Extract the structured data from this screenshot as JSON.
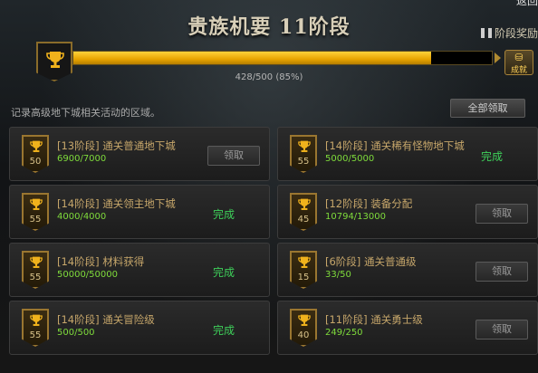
{
  "header": {
    "corner_label": "返回",
    "title": "贵族机要 11阶段",
    "stage_reward_label": "阶段奖励",
    "achievement_label": "成就",
    "progress_text": "428/500 (85%)",
    "progress_fraction": 0.856
  },
  "description": "记录高级地下城相关活动的区域。",
  "all_claim_label": "全部领取",
  "colors": {
    "gold": "#e8a400",
    "done": "#3ed05a",
    "progress": "#7fdc3b"
  },
  "quests": [
    {
      "level": "50",
      "name": "[13阶段] 通关普通地下城",
      "progress": "6900/7000",
      "status": "领取",
      "state": "claim"
    },
    {
      "level": "55",
      "name": "[14阶段] 通关稀有怪物地下城",
      "progress": "5000/5000",
      "status": "完成",
      "state": "done"
    },
    {
      "level": "55",
      "name": "[14阶段] 通关领主地下城",
      "progress": "4000/4000",
      "status": "完成",
      "state": "done"
    },
    {
      "level": "45",
      "name": "[12阶段] 装备分配",
      "progress": "10794/13000",
      "status": "领取",
      "state": "claim"
    },
    {
      "level": "55",
      "name": "[14阶段] 材料获得",
      "progress": "50000/50000",
      "status": "完成",
      "state": "done"
    },
    {
      "level": "15",
      "name": "[6阶段] 通关普通级",
      "progress": "33/50",
      "status": "领取",
      "state": "claim"
    },
    {
      "level": "55",
      "name": "[14阶段] 通关冒险级",
      "progress": "500/500",
      "status": "完成",
      "state": "done"
    },
    {
      "level": "40",
      "name": "[11阶段] 通关勇士级",
      "progress": "249/250",
      "status": "领取",
      "state": "claim"
    }
  ]
}
